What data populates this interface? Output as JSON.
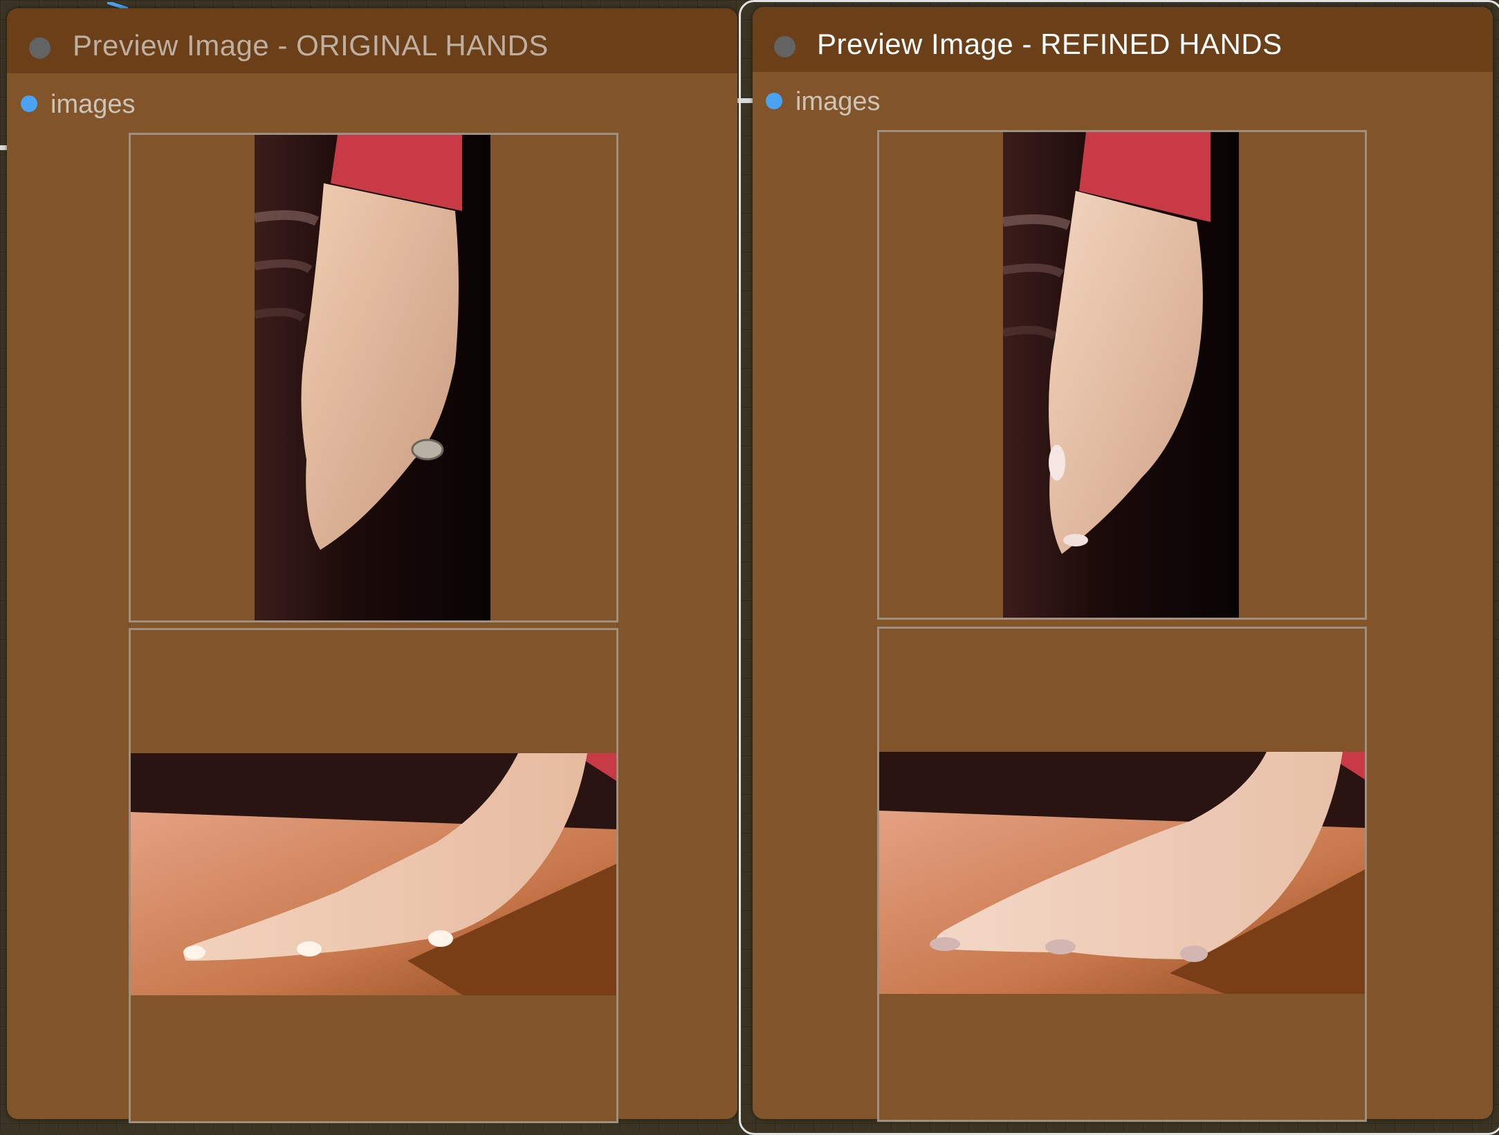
{
  "nodes": [
    {
      "title": "Preview Image - ORIGINAL HANDS",
      "slot_label": "images",
      "title_color": "#bdb0a3"
    },
    {
      "title": "Preview Image - REFINED HANDS",
      "slot_label": "images",
      "title_color": "#ffffff"
    }
  ],
  "images": [
    "vertical hand beside dark leather, red sleeve cuff, ring on finger",
    "horizontal hand resting flat on wooden table",
    "vertical hand beside dark leather, red sleeve cuff",
    "horizontal hand resting flat on wooden table, manicured nails"
  ],
  "colors": {
    "canvas": "#3a3424",
    "node_body": "#82542a",
    "node_header": "#6b3f17",
    "slot_dot": "#4aa3f0",
    "status_dot": "#636363"
  }
}
